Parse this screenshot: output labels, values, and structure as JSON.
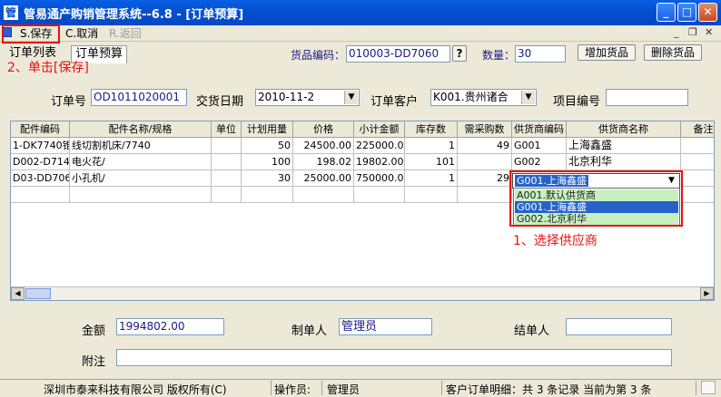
{
  "window": {
    "title": "管易通产购销管理系统--6.8 - [订单预算]",
    "icon": "app-icon"
  },
  "toolbar": {
    "save_label": "S.保存",
    "cancel_label": "C.取消",
    "back_label": "R.返回"
  },
  "tabs": [
    {
      "label": "订单列表"
    },
    {
      "label": "订单预算"
    }
  ],
  "product_lookup": {
    "code_label": "货品编码：",
    "code_value": "010003-DD7060",
    "help_button": "?",
    "qty_label": "数量：",
    "qty_value": "30",
    "add_button": "增加货品",
    "delete_button": "删除货品"
  },
  "order": {
    "order_no_label": "订单号",
    "order_no_value": "OD1011020001",
    "date_label": "交货日期",
    "date_value": "2010-11-2",
    "customer_label": "订单客户",
    "customer_value": "K001.贵州诸合",
    "project_label": "项目编号",
    "project_value": ""
  },
  "grid": {
    "headers": [
      "配件编码",
      "配件名称/规格",
      "单位",
      "计划用量",
      "价格",
      "小计金额",
      "库存数",
      "需采购数",
      "供货商编码",
      "供货商名称",
      "备注"
    ],
    "rows": [
      [
        "1-DK7740锥",
        "线切割机床/7740",
        "",
        "50",
        "24500.00",
        "225000.00",
        "1",
        "49",
        "G001",
        "上海鑫盛",
        ""
      ],
      [
        "D002-D7140",
        "电火花/",
        "",
        "100",
        "198.02",
        "19802.00",
        "101",
        "",
        "G002",
        "北京利华",
        ""
      ],
      [
        "D03-DD7060",
        "小孔机/",
        "",
        "30",
        "25000.00",
        "750000.00",
        "1",
        "29",
        "",
        "",
        ""
      ]
    ],
    "supplier_combo_value": "G001.上海鑫盛"
  },
  "supplier_options": [
    "A001.默认供货商",
    "G001.上海鑫盛",
    "G002.北京利华"
  ],
  "annotations": {
    "step1": "1、选择供应商",
    "step2": "2、单击[保存]"
  },
  "footer": {
    "amount_label": "金额",
    "amount_value": "1994802.00",
    "creator_label": "制单人",
    "creator_value": "管理员",
    "settler_label": "结单人",
    "settler_value": "",
    "note_label": "附注",
    "note_value": ""
  },
  "status": {
    "company": "深圳市泰来科技有限公司 版权所有(C)",
    "operator_label": "操作员:",
    "operator_value": "管理员",
    "record_info": "客户订单明细：共 3 条记录 当前为第 3 条"
  },
  "colors": {
    "annotation_red": "#e81010",
    "titlebar_blue": "#0350d0",
    "selection_blue": "#2862c8",
    "option_green": "#c7f0c0"
  }
}
